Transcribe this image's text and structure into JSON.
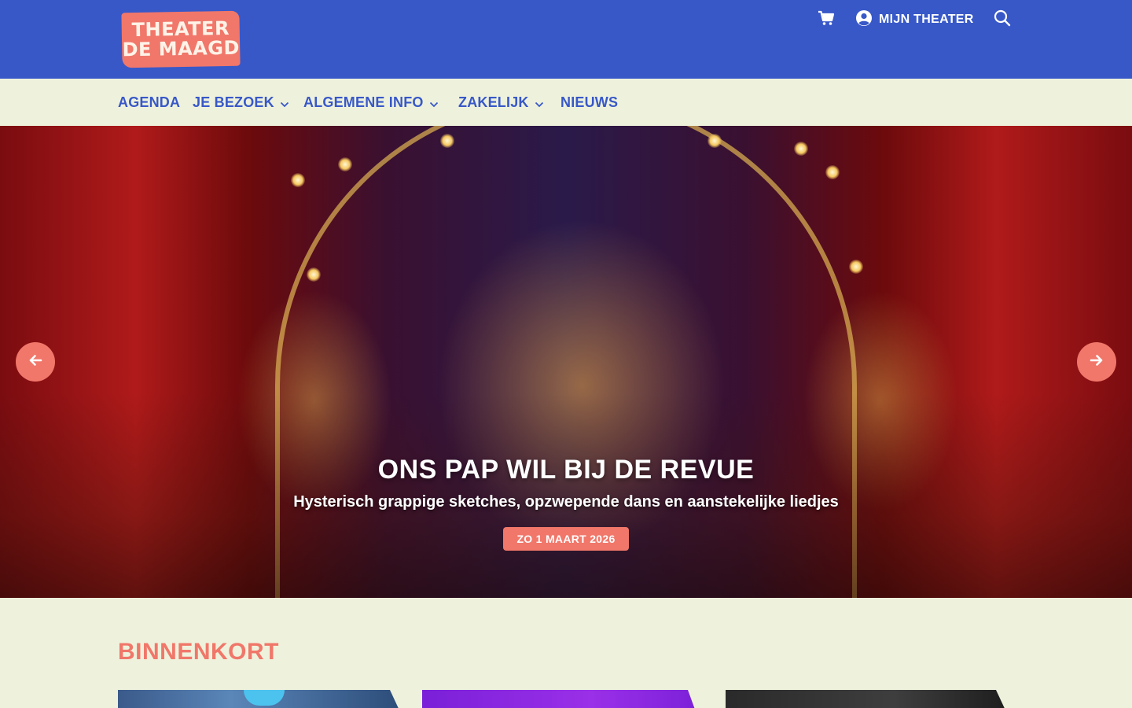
{
  "header": {
    "logo_line1": "THEATER",
    "logo_line2": "DE MAAGD",
    "account_label": "MIJN THEATER",
    "icons": [
      "cart-icon",
      "user-circle-icon",
      "search-icon"
    ]
  },
  "nav": {
    "items": [
      {
        "label": "AGENDA",
        "has_dropdown": false
      },
      {
        "label": "JE BEZOEK",
        "has_dropdown": true
      },
      {
        "label": "ALGEMENE INFO",
        "has_dropdown": true
      },
      {
        "label": "ZAKELIJK",
        "has_dropdown": true
      },
      {
        "label": "NIEUWS",
        "has_dropdown": false
      }
    ]
  },
  "hero": {
    "title": "ONS PAP WIL BIJ DE REVUE",
    "subtitle": "Hysterisch grappige sketches, opzwepende dans en aanstekelijke liedjes",
    "date": "ZO 1 MAART 2026"
  },
  "section": {
    "title": "BINNENKORT"
  },
  "colors": {
    "header_blue": "#3858c8",
    "nav_background": "#eef2dc",
    "accent_coral": "#f0776a",
    "text_white": "#ffffff"
  }
}
